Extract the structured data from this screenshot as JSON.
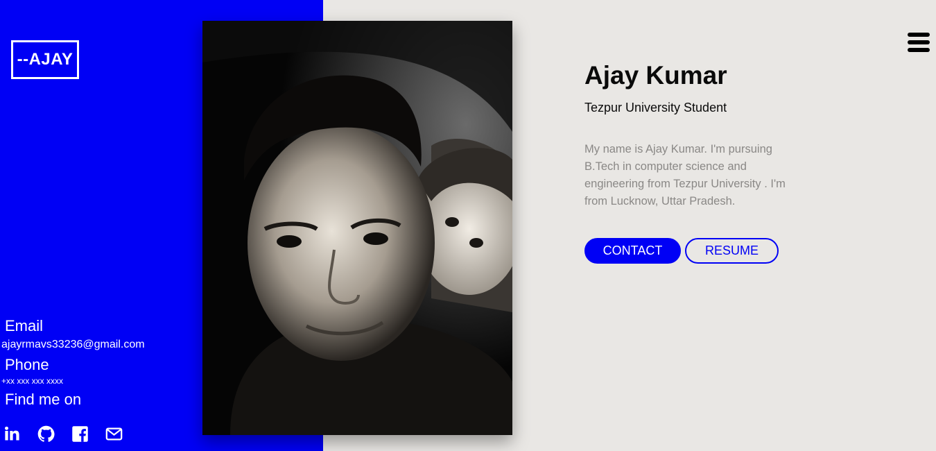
{
  "logo": {
    "text": "--AJAY"
  },
  "contact": {
    "email_heading": "Email",
    "email_value": "ajayrmavs33236@gmail.com",
    "phone_heading": "Phone",
    "phone_value": "+xx xxx xxx xxxx",
    "social_heading": "Find me on",
    "socials": [
      "linkedin-icon",
      "github-icon",
      "facebook-icon",
      "mail-icon"
    ]
  },
  "profile": {
    "name": "Ajay Kumar",
    "subtitle": "Tezpur University Student",
    "bio": "My name is Ajay Kumar. I'm pursuing B.Tech in computer science and engineering from Tezpur University . I'm from Lucknow, Uttar Pradesh."
  },
  "buttons": {
    "contact": "CONTACT",
    "resume": "RESUME"
  },
  "colors": {
    "accent": "#0000f5",
    "background": "#e9e7e4",
    "bio_text": "#8a8886"
  },
  "icons": {
    "menu": "hamburger-menu-icon"
  }
}
